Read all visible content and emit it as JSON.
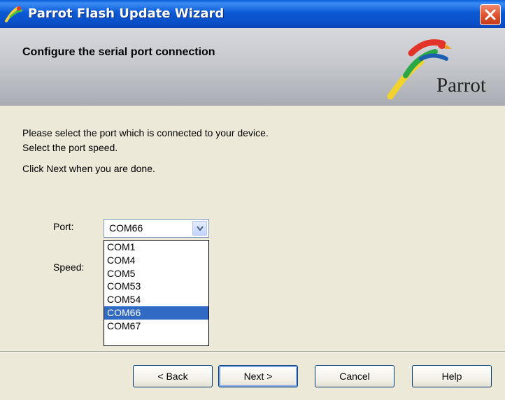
{
  "window": {
    "title": "Parrot Flash Update Wizard",
    "close_icon": "close-icon"
  },
  "header": {
    "heading": "Configure the serial port connection",
    "logo_text": "Parrot"
  },
  "instructions": {
    "line1": "Please select the port which is connected to your device.",
    "line2": "Select the port speed.",
    "line3": "Click Next when you are done."
  },
  "port": {
    "label": "Port:",
    "selected": "COM66",
    "options": [
      "COM1",
      "COM4",
      "COM5",
      "COM53",
      "COM54",
      "COM66",
      "COM67"
    ]
  },
  "speed": {
    "label": "Speed:"
  },
  "buttons": {
    "back": "< Back",
    "next": "Next >",
    "cancel": "Cancel",
    "help": "Help"
  }
}
